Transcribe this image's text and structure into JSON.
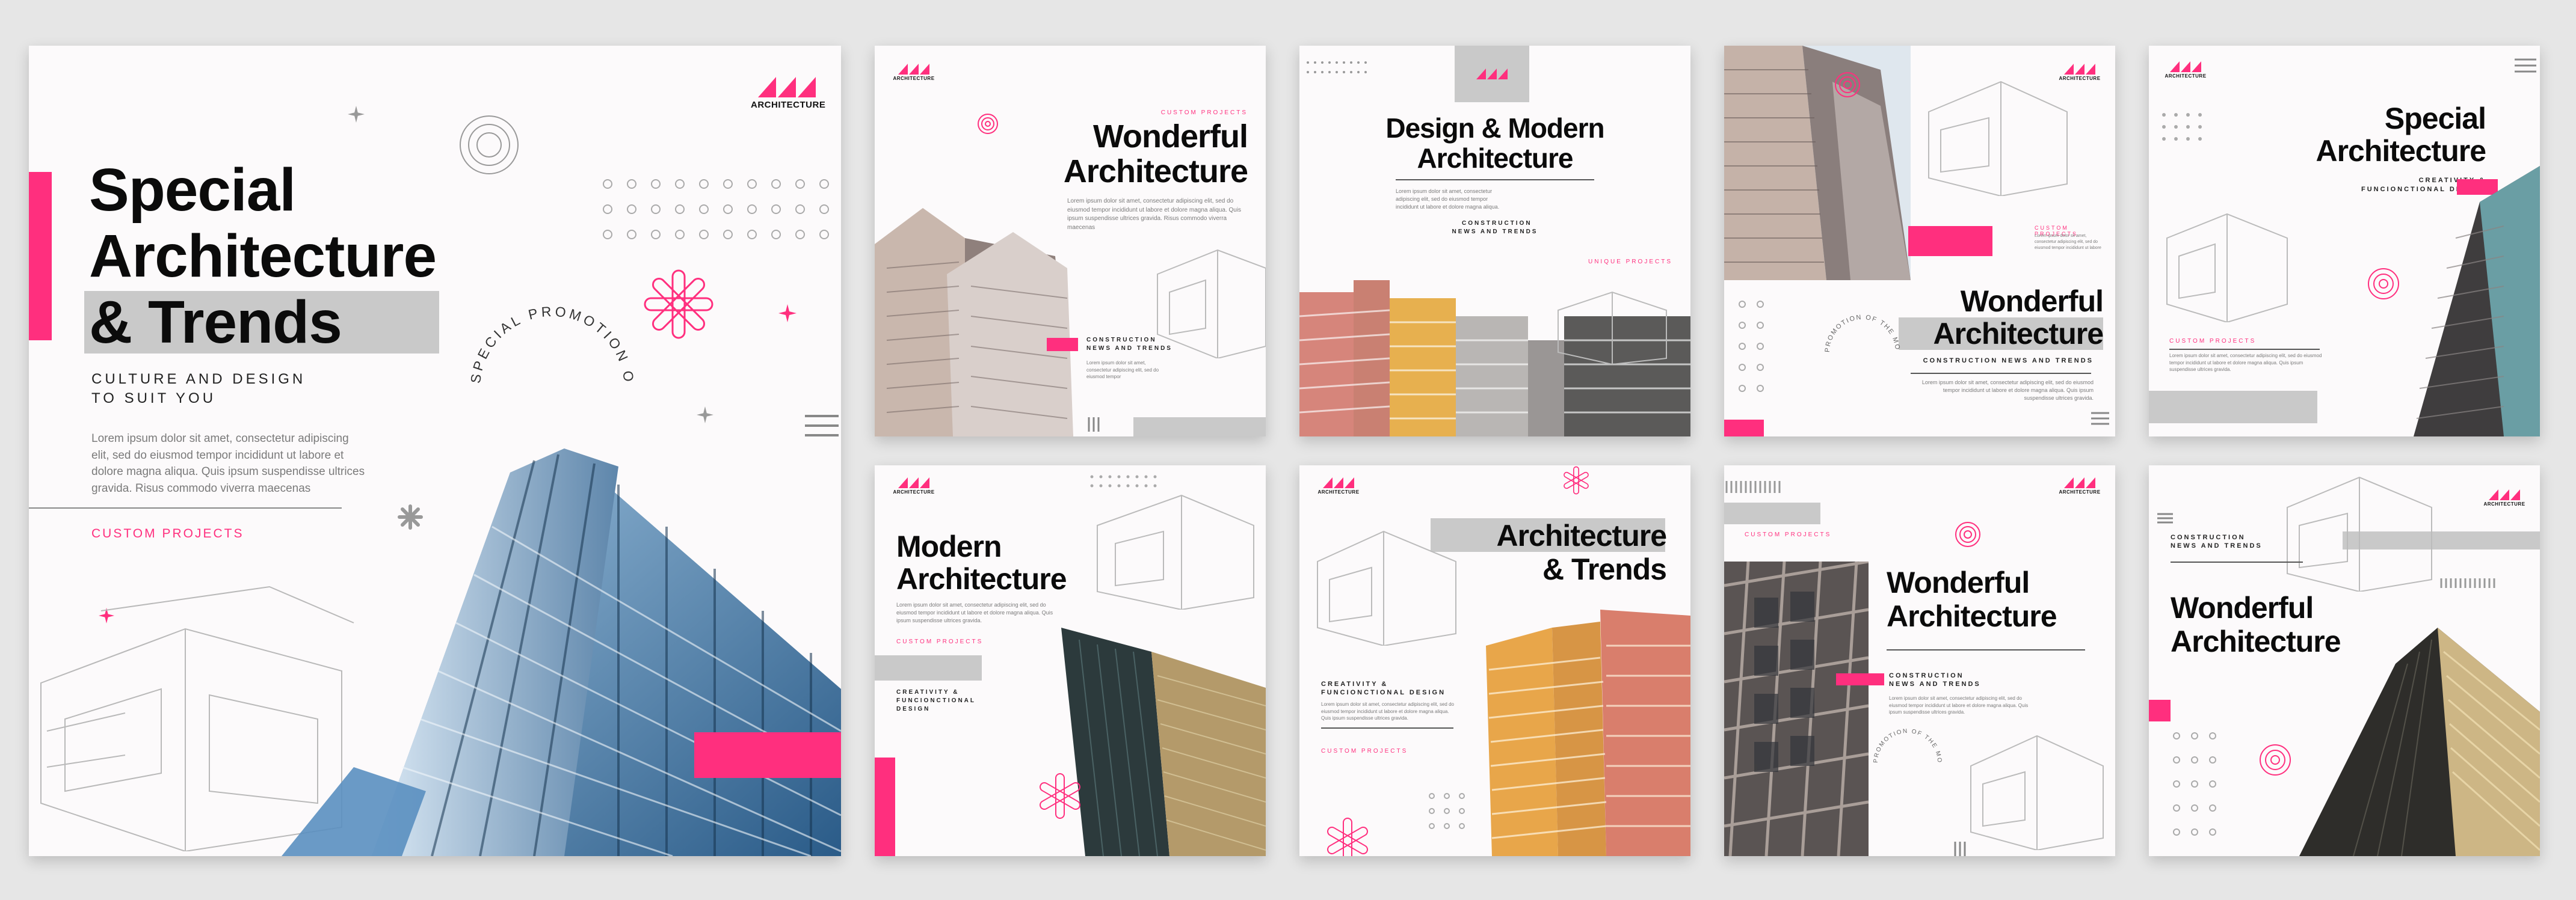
{
  "brand": {
    "logo_text": "ARCHITECTURE",
    "accent_color": "#ff2f7e",
    "gray_color": "#c9c9c9"
  },
  "cover": {
    "title_line1": "Special",
    "title_line2": "Architecture",
    "title_line3": "& Trends",
    "subtitle_line1": "CULTURE AND DESIGN",
    "subtitle_line2": "TO SUIT YOU",
    "body": "Lorem ipsum dolor sit amet, consectetur adipiscing elit, sed do eiusmod tempor incididunt ut labore et dolore magna aliqua. Quis ipsum suspendisse ultrices gravida. Risus commodo viverra maecenas",
    "tag": "CUSTOM PROJECTS",
    "circle_text": "SPECIAL PROMOTION OF THE MONTH"
  },
  "posts": [
    {
      "tag": "CUSTOM PROJECTS",
      "title_line1": "Wonderful",
      "title_line2": "Architecture",
      "body": "Lorem ipsum dolor sit amet, consectetur adipiscing elit, sed do eiusmod tempor incididunt ut labore et dolore magna aliqua. Quis ipsum suspendisse ultrices gravida. Risus commodo viverra maecenas",
      "caption_line1": "CONSTRUCTION",
      "caption_line2": "NEWS AND TRENDS",
      "small_body": "Lorem ipsum dolor sit amet, consectetur adipiscing elit, sed do eiusmod tempor"
    },
    {
      "title_line1": "Design & Modern",
      "title_line2": "Architecture",
      "body": "Lorem ipsum dolor sit amet, consectetur adipiscing elit, sed do eiusmod tempor incididunt ut labore et dolore magna aliqua.",
      "caption_line1": "CONSTRUCTION",
      "caption_line2": "NEWS AND TRENDS",
      "tag": "UNIQUE PROJECTS"
    },
    {
      "tag": "CUSTOM PROJECTS",
      "body_top": "Lorem ipsum dolor sit amet, consectetur adipiscing elit, sed do eiusmod tempor incididunt ut labore",
      "circle_text": "PROMOTION OF THE MONTH",
      "title_line1": "Wonderful",
      "title_line2": "Architecture",
      "caption": "CONSTRUCTION NEWS AND TRENDS",
      "body": "Lorem ipsum dolor sit amet, consectetur adipiscing elit, sed do eiusmod tempor incididunt ut labore et dolore magna aliqua. Quis ipsum suspendisse ultrices gravida."
    },
    {
      "title_line1": "Special",
      "title_line2": "Architecture",
      "caption_line1": "CREATIVITY &",
      "caption_line2": "FUNCIONCTIONAL DESIGN",
      "tag": "CUSTOM PROJECTS",
      "body": "Lorem ipsum dolor sit amet, consectetur adipiscing elit, sed do eiusmod tempor incididunt ut labore et dolore magna aliqua. Quis ipsum suspendisse ultrices gravida."
    },
    {
      "title_line1": "Modern",
      "title_line2": "Architecture",
      "body": "Lorem ipsum dolor sit amet, consectetur adipiscing elit, sed do eiusmod tempor incididunt ut labore et dolore magna aliqua. Quis ipsum suspendisse ultrices gravida.",
      "tag": "CUSTOM PROJECTS",
      "caption_line1": "CREATIVITY &",
      "caption_line2": "FUNCIONCTIONAL",
      "caption_line3": "DESIGN"
    },
    {
      "title_line1": "Architecture",
      "title_line2": "& Trends",
      "caption_line1": "CREATIVITY &",
      "caption_line2": "FUNCIONCTIONAL DESIGN",
      "body": "Lorem ipsum dolor sit amet, consectetur adipiscing elit, sed do eiusmod tempor incididunt ut labore et dolore magna aliqua. Quis ipsum suspendisse ultrices gravida.",
      "tag": "CUSTOM PROJECTS"
    },
    {
      "tag": "CUSTOM PROJECTS",
      "title_line1": "Wonderful",
      "title_line2": "Architecture",
      "caption_line1": "CONSTRUCTION",
      "caption_line2": "NEWS AND TRENDS",
      "body": "Lorem ipsum dolor sit amet, consectetur adipiscing elit, sed do eiusmod tempor incididunt ut labore et dolore magna aliqua. Quis ipsum suspendisse ultrices gravida.",
      "circle_text": "PROMOTION OF THE MONTH"
    },
    {
      "caption_line1": "CONSTRUCTION",
      "caption_line2": "NEWS AND TRENDS",
      "title_line1": "Wonderful",
      "title_line2": "Architecture"
    }
  ]
}
